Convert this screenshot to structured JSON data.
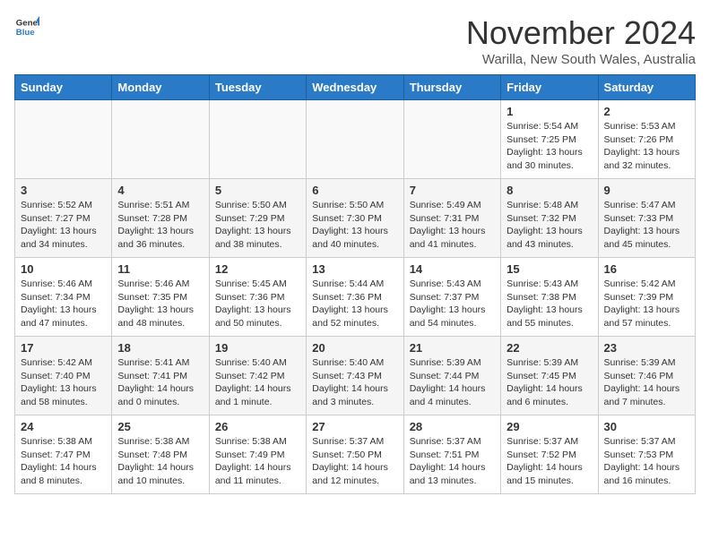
{
  "logo": {
    "line1": "General",
    "line2": "Blue"
  },
  "title": "November 2024",
  "subtitle": "Warilla, New South Wales, Australia",
  "weekdays": [
    "Sunday",
    "Monday",
    "Tuesday",
    "Wednesday",
    "Thursday",
    "Friday",
    "Saturday"
  ],
  "weeks": [
    [
      {
        "day": "",
        "info": ""
      },
      {
        "day": "",
        "info": ""
      },
      {
        "day": "",
        "info": ""
      },
      {
        "day": "",
        "info": ""
      },
      {
        "day": "",
        "info": ""
      },
      {
        "day": "1",
        "sunrise": "Sunrise: 5:54 AM",
        "sunset": "Sunset: 7:25 PM",
        "daylight": "Daylight: 13 hours and 30 minutes."
      },
      {
        "day": "2",
        "sunrise": "Sunrise: 5:53 AM",
        "sunset": "Sunset: 7:26 PM",
        "daylight": "Daylight: 13 hours and 32 minutes."
      }
    ],
    [
      {
        "day": "3",
        "sunrise": "Sunrise: 5:52 AM",
        "sunset": "Sunset: 7:27 PM",
        "daylight": "Daylight: 13 hours and 34 minutes."
      },
      {
        "day": "4",
        "sunrise": "Sunrise: 5:51 AM",
        "sunset": "Sunset: 7:28 PM",
        "daylight": "Daylight: 13 hours and 36 minutes."
      },
      {
        "day": "5",
        "sunrise": "Sunrise: 5:50 AM",
        "sunset": "Sunset: 7:29 PM",
        "daylight": "Daylight: 13 hours and 38 minutes."
      },
      {
        "day": "6",
        "sunrise": "Sunrise: 5:50 AM",
        "sunset": "Sunset: 7:30 PM",
        "daylight": "Daylight: 13 hours and 40 minutes."
      },
      {
        "day": "7",
        "sunrise": "Sunrise: 5:49 AM",
        "sunset": "Sunset: 7:31 PM",
        "daylight": "Daylight: 13 hours and 41 minutes."
      },
      {
        "day": "8",
        "sunrise": "Sunrise: 5:48 AM",
        "sunset": "Sunset: 7:32 PM",
        "daylight": "Daylight: 13 hours and 43 minutes."
      },
      {
        "day": "9",
        "sunrise": "Sunrise: 5:47 AM",
        "sunset": "Sunset: 7:33 PM",
        "daylight": "Daylight: 13 hours and 45 minutes."
      }
    ],
    [
      {
        "day": "10",
        "sunrise": "Sunrise: 5:46 AM",
        "sunset": "Sunset: 7:34 PM",
        "daylight": "Daylight: 13 hours and 47 minutes."
      },
      {
        "day": "11",
        "sunrise": "Sunrise: 5:46 AM",
        "sunset": "Sunset: 7:35 PM",
        "daylight": "Daylight: 13 hours and 48 minutes."
      },
      {
        "day": "12",
        "sunrise": "Sunrise: 5:45 AM",
        "sunset": "Sunset: 7:36 PM",
        "daylight": "Daylight: 13 hours and 50 minutes."
      },
      {
        "day": "13",
        "sunrise": "Sunrise: 5:44 AM",
        "sunset": "Sunset: 7:36 PM",
        "daylight": "Daylight: 13 hours and 52 minutes."
      },
      {
        "day": "14",
        "sunrise": "Sunrise: 5:43 AM",
        "sunset": "Sunset: 7:37 PM",
        "daylight": "Daylight: 13 hours and 54 minutes."
      },
      {
        "day": "15",
        "sunrise": "Sunrise: 5:43 AM",
        "sunset": "Sunset: 7:38 PM",
        "daylight": "Daylight: 13 hours and 55 minutes."
      },
      {
        "day": "16",
        "sunrise": "Sunrise: 5:42 AM",
        "sunset": "Sunset: 7:39 PM",
        "daylight": "Daylight: 13 hours and 57 minutes."
      }
    ],
    [
      {
        "day": "17",
        "sunrise": "Sunrise: 5:42 AM",
        "sunset": "Sunset: 7:40 PM",
        "daylight": "Daylight: 13 hours and 58 minutes."
      },
      {
        "day": "18",
        "sunrise": "Sunrise: 5:41 AM",
        "sunset": "Sunset: 7:41 PM",
        "daylight": "Daylight: 14 hours and 0 minutes."
      },
      {
        "day": "19",
        "sunrise": "Sunrise: 5:40 AM",
        "sunset": "Sunset: 7:42 PM",
        "daylight": "Daylight: 14 hours and 1 minute."
      },
      {
        "day": "20",
        "sunrise": "Sunrise: 5:40 AM",
        "sunset": "Sunset: 7:43 PM",
        "daylight": "Daylight: 14 hours and 3 minutes."
      },
      {
        "day": "21",
        "sunrise": "Sunrise: 5:39 AM",
        "sunset": "Sunset: 7:44 PM",
        "daylight": "Daylight: 14 hours and 4 minutes."
      },
      {
        "day": "22",
        "sunrise": "Sunrise: 5:39 AM",
        "sunset": "Sunset: 7:45 PM",
        "daylight": "Daylight: 14 hours and 6 minutes."
      },
      {
        "day": "23",
        "sunrise": "Sunrise: 5:39 AM",
        "sunset": "Sunset: 7:46 PM",
        "daylight": "Daylight: 14 hours and 7 minutes."
      }
    ],
    [
      {
        "day": "24",
        "sunrise": "Sunrise: 5:38 AM",
        "sunset": "Sunset: 7:47 PM",
        "daylight": "Daylight: 14 hours and 8 minutes."
      },
      {
        "day": "25",
        "sunrise": "Sunrise: 5:38 AM",
        "sunset": "Sunset: 7:48 PM",
        "daylight": "Daylight: 14 hours and 10 minutes."
      },
      {
        "day": "26",
        "sunrise": "Sunrise: 5:38 AM",
        "sunset": "Sunset: 7:49 PM",
        "daylight": "Daylight: 14 hours and 11 minutes."
      },
      {
        "day": "27",
        "sunrise": "Sunrise: 5:37 AM",
        "sunset": "Sunset: 7:50 PM",
        "daylight": "Daylight: 14 hours and 12 minutes."
      },
      {
        "day": "28",
        "sunrise": "Sunrise: 5:37 AM",
        "sunset": "Sunset: 7:51 PM",
        "daylight": "Daylight: 14 hours and 13 minutes."
      },
      {
        "day": "29",
        "sunrise": "Sunrise: 5:37 AM",
        "sunset": "Sunset: 7:52 PM",
        "daylight": "Daylight: 14 hours and 15 minutes."
      },
      {
        "day": "30",
        "sunrise": "Sunrise: 5:37 AM",
        "sunset": "Sunset: 7:53 PM",
        "daylight": "Daylight: 14 hours and 16 minutes."
      }
    ]
  ]
}
